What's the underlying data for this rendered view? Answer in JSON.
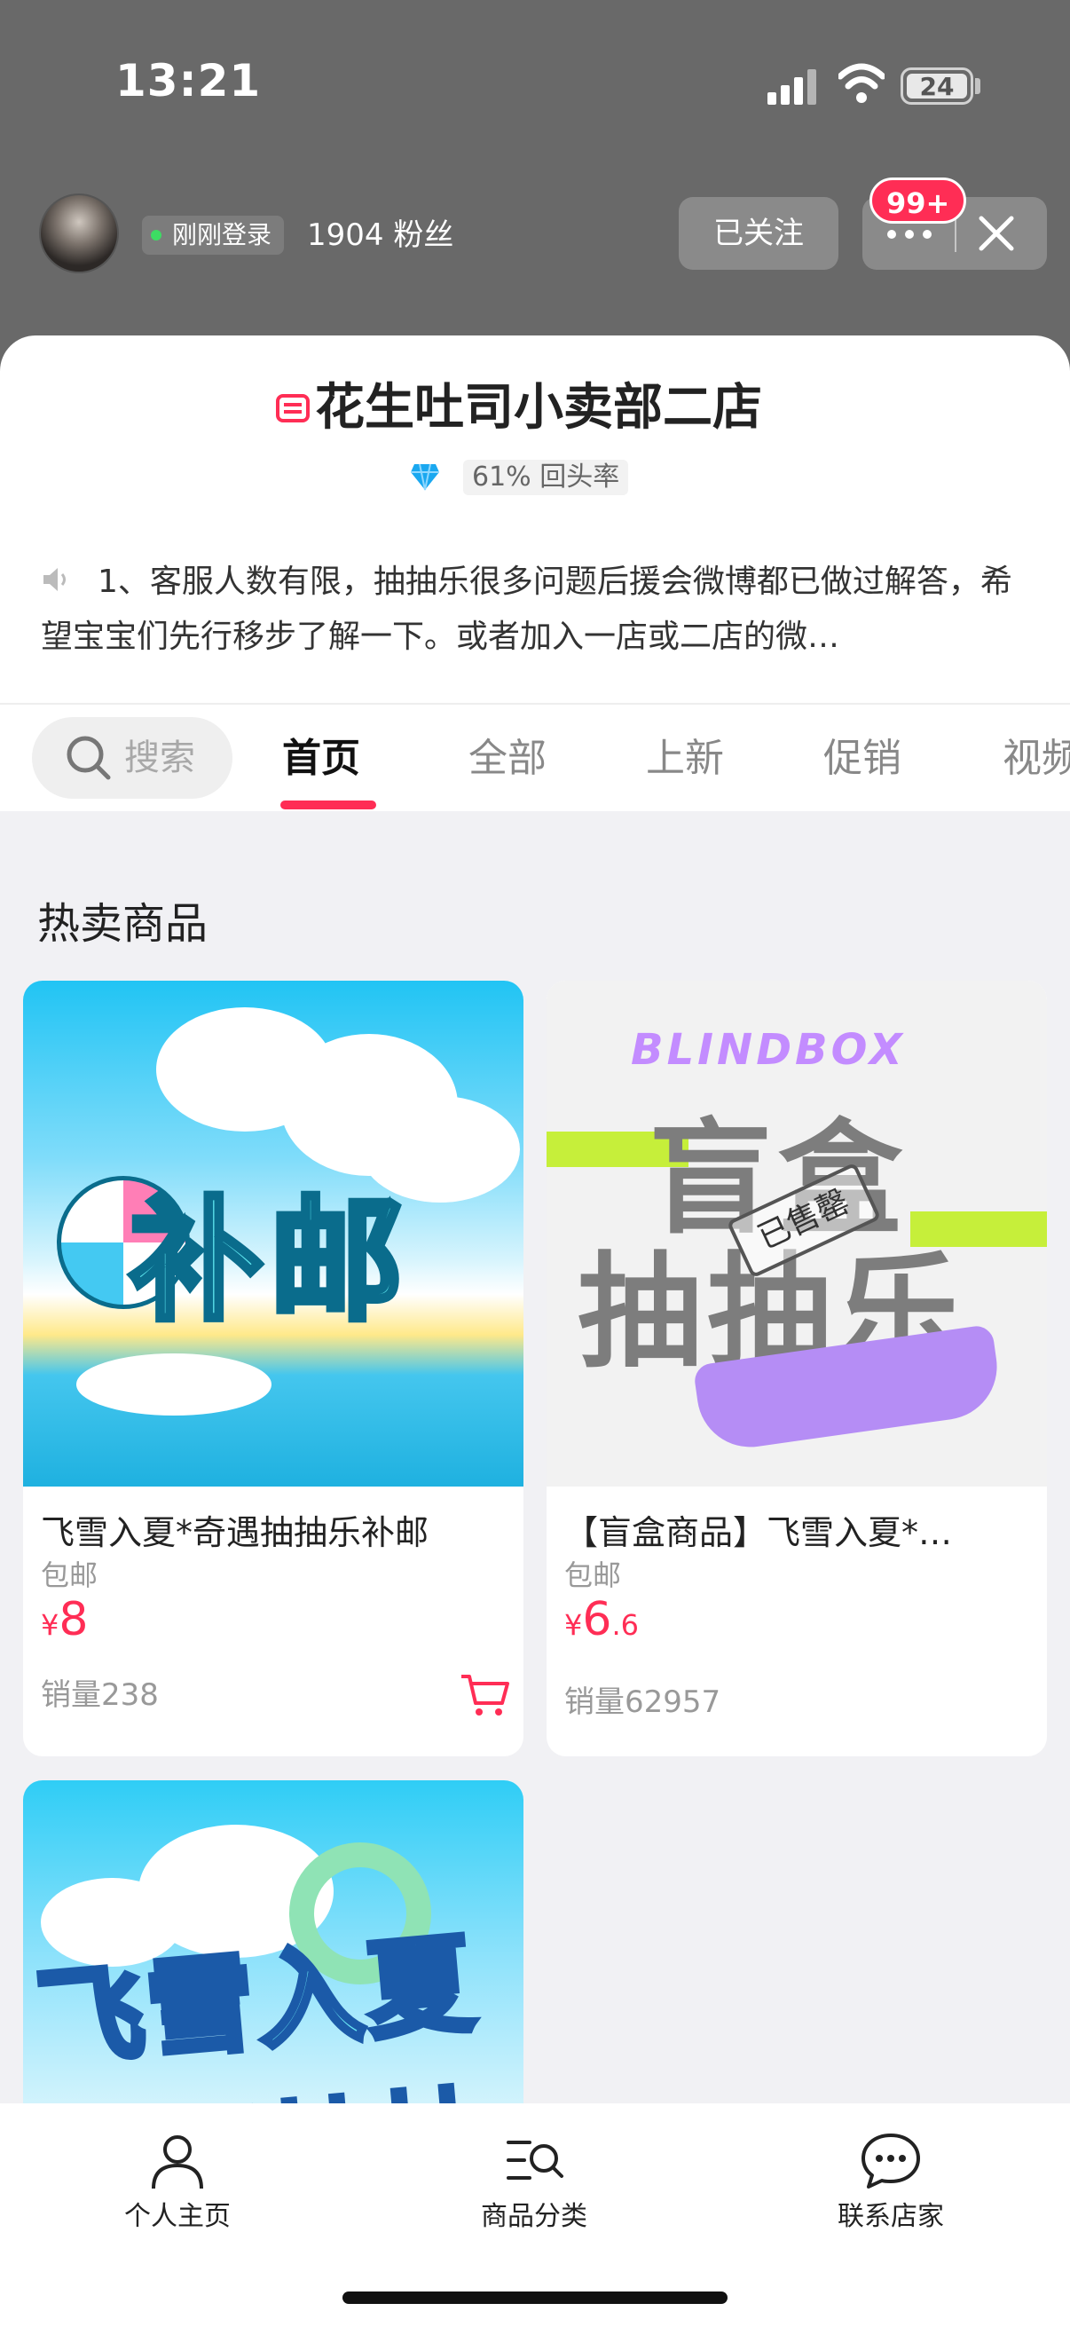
{
  "status_bar": {
    "time": "13:21",
    "battery": "24"
  },
  "header": {
    "login_status": "刚刚登录",
    "fans": "1904 粉丝",
    "follow_label": "已关注",
    "badge": "99+"
  },
  "shop": {
    "name": "花生吐司小卖部二店",
    "return_rate": "61% 回头率",
    "notice": "1、客服人数有限，抽抽乐很多问题后援会微博都已做过解答，希望宝宝们先行移步了解一下。或者加入一店或二店的微…"
  },
  "tabs": {
    "search_placeholder": "搜索",
    "items": [
      "首页",
      "全部",
      "上新",
      "促销",
      "视频"
    ]
  },
  "section": {
    "title": "热卖商品"
  },
  "products": [
    {
      "image_text": "补邮",
      "name": "飞雪入夏*奇遇抽抽乐补邮",
      "shipping": "包邮",
      "price_symbol": "¥",
      "price_int": "8",
      "price_dec": "",
      "sales": "销量238"
    },
    {
      "image_top": "BLINDBOX",
      "image_line1": "盲盒",
      "image_line2": "抽抽乐",
      "stamp": "已售罄",
      "name": "【盲盒商品】飞雪入夏*…",
      "shipping": "包邮",
      "price_symbol": "¥",
      "price_int": "6",
      "price_dec": ".6",
      "sales": "销量62957"
    },
    {
      "image_line1": "飞雪入夏",
      "image_line2": "奇遇抽抽乐"
    }
  ],
  "bottom_nav": [
    {
      "label": "个人主页",
      "icon": "person-icon"
    },
    {
      "label": "商品分类",
      "icon": "category-search-icon"
    },
    {
      "label": "联系店家",
      "icon": "chat-icon"
    }
  ],
  "colors": {
    "accent": "#ff2d55",
    "top_bg": "#696969"
  }
}
